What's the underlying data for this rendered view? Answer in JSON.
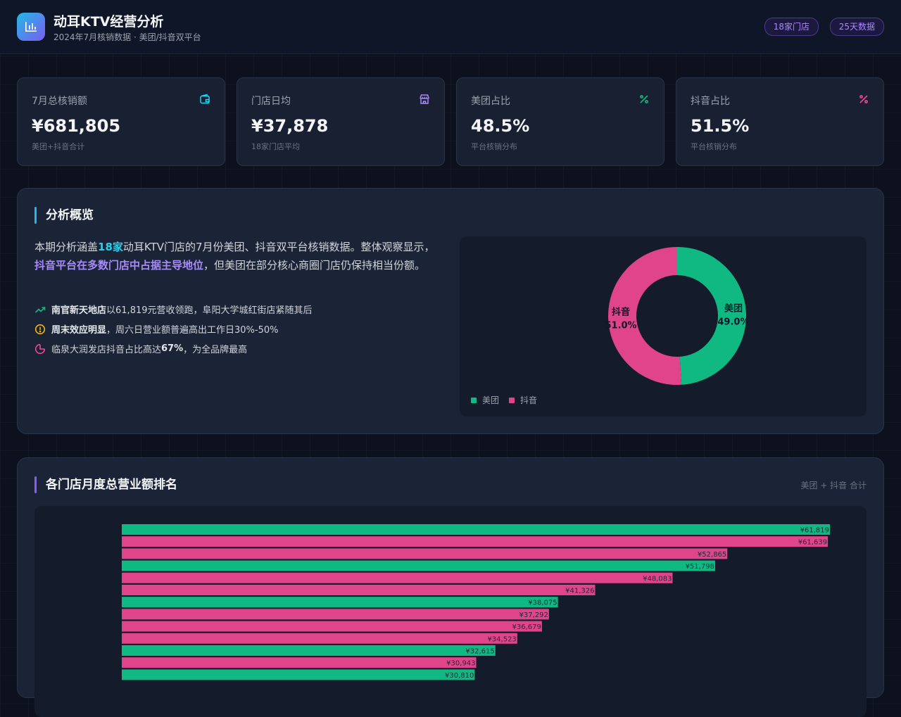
{
  "header": {
    "title": "动耳KTV经营分析",
    "subtitle": "2024年7月核销数据 · 美团/抖音双平台",
    "badge_stores": "18家门店",
    "badge_days": "25天数据"
  },
  "kpis": [
    {
      "label": "7月总核销额",
      "value": "¥681,805",
      "note": "美团+抖音合计",
      "icon": "wallet-icon",
      "color": "#22d3ee"
    },
    {
      "label": "门店日均",
      "value": "¥37,878",
      "note": "18家门店平均",
      "icon": "store-icon",
      "color": "#a78bfa"
    },
    {
      "label": "美团占比",
      "value": "48.5%",
      "note": "平台核销分布",
      "icon": "percent-icon",
      "color": "#10b981"
    },
    {
      "label": "抖音占比",
      "value": "51.5%",
      "note": "平台核销分布",
      "icon": "percent-icon",
      "color": "#ec4899"
    }
  ],
  "overview": {
    "title": "分析概览",
    "summary_1": "本期分析涵盖",
    "summary_hl1": "18家",
    "summary_2": "动耳KTV门店的7月份美团、抖音双平台核销数据。整体观察显示，",
    "summary_hl2": "抖音平台在多数门店中占据主导地位",
    "summary_3": "，但美团在部分核心商圈门店仍保持相当份额。",
    "insights": [
      {
        "icon": "trending-up-icon",
        "bold": "南官新天地店",
        "text": "以61,819元营收领跑，阜阳大学城红街店紧随其后"
      },
      {
        "icon": "alert-circle-icon",
        "bold": "周末效应明显",
        "text": "，周六日营业额普遍高出工作日30%-50%"
      },
      {
        "icon": "pie-icon",
        "bold": "",
        "text_pre": "临泉大润发店抖音占比高达",
        "bold2": "67%",
        "text": "，为全品牌最高"
      }
    ]
  },
  "donut": {
    "legend": [
      "美团",
      "抖音"
    ],
    "labels": [
      "美团",
      "抖音"
    ],
    "percents": [
      "49.0%",
      "51.0%"
    ],
    "colors": {
      "meituan": "#10b981",
      "douyin": "#e0448a"
    }
  },
  "ranking": {
    "title": "各门店月度总营业额排名",
    "hint": "美团 + 抖音 合计"
  },
  "chart_data": [
    {
      "type": "pie",
      "categories": [
        "美团",
        "抖音"
      ],
      "values": [
        49.0,
        51.0
      ]
    },
    {
      "type": "bar",
      "title": "各门店月度总营业额排名",
      "values": [
        61819,
        61639,
        52865,
        51798,
        48083,
        41326,
        38075,
        37292,
        36679,
        34523,
        32615,
        30943,
        30810
      ],
      "labels": [
        "¥61,819",
        "¥61,639",
        "¥52,865",
        "¥51,798",
        "¥48,083",
        "¥41,326",
        "¥38,075",
        "¥37,292",
        "¥36,679",
        "¥34,523",
        "¥32,615",
        "¥30,943",
        "¥30,810"
      ],
      "colors": [
        "#10b981",
        "#e0448a",
        "#e0448a",
        "#10b981",
        "#e0448a",
        "#e0448a",
        "#10b981",
        "#e0448a",
        "#e0448a",
        "#e0448a",
        "#10b981",
        "#e0448a",
        "#10b981"
      ],
      "xlim": [
        0,
        61819
      ]
    }
  ]
}
